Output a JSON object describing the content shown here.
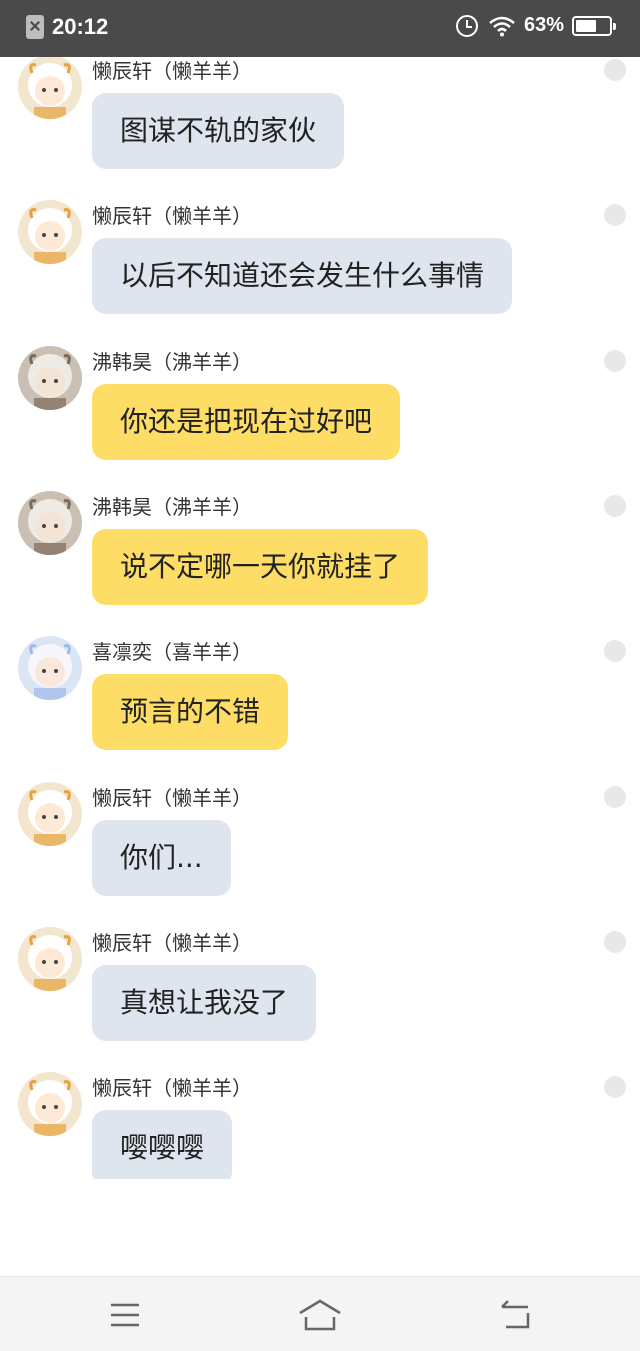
{
  "status_bar": {
    "time": "20:12",
    "battery_percent": "63%",
    "battery_level": 0.63,
    "icons": [
      "sim-error-icon",
      "alarm-icon",
      "wifi-icon",
      "battery-icon"
    ]
  },
  "colors": {
    "status_bar_bg": "#4a4a4a",
    "bubble_gray": "#dfe5ee",
    "bubble_yellow": "#fddd66",
    "nav_bar_bg": "#f4f4f4"
  },
  "messages": [
    {
      "sender": "懒辰轩（懒羊羊）",
      "text": "图谋不轨的家伙",
      "avatar": "avatar-lazy-sheep",
      "bubble": "gray"
    },
    {
      "sender": "懒辰轩（懒羊羊）",
      "text": "以后不知道还会发生什么事情",
      "avatar": "avatar-lazy-sheep",
      "bubble": "gray"
    },
    {
      "sender": "沸韩昊（沸羊羊）",
      "text": "你还是把现在过好吧",
      "avatar": "avatar-fei-sheep",
      "bubble": "yellow"
    },
    {
      "sender": "沸韩昊（沸羊羊）",
      "text": "说不定哪一天你就挂了",
      "avatar": "avatar-fei-sheep",
      "bubble": "yellow"
    },
    {
      "sender": "喜凛奕（喜羊羊）",
      "text": "预言的不错",
      "avatar": "avatar-happy-sheep",
      "bubble": "yellow"
    },
    {
      "sender": "懒辰轩（懒羊羊）",
      "text": "你们...",
      "avatar": "avatar-lazy-sheep",
      "bubble": "gray"
    },
    {
      "sender": "懒辰轩（懒羊羊）",
      "text": "真想让我没了",
      "avatar": "avatar-lazy-sheep",
      "bubble": "gray"
    },
    {
      "sender": "懒辰轩（懒羊羊）",
      "text": "嘤嘤嘤",
      "avatar": "avatar-lazy-sheep",
      "bubble": "gray"
    }
  ],
  "nav_bar": {
    "buttons": [
      "menu-icon",
      "home-icon",
      "back-icon"
    ]
  }
}
